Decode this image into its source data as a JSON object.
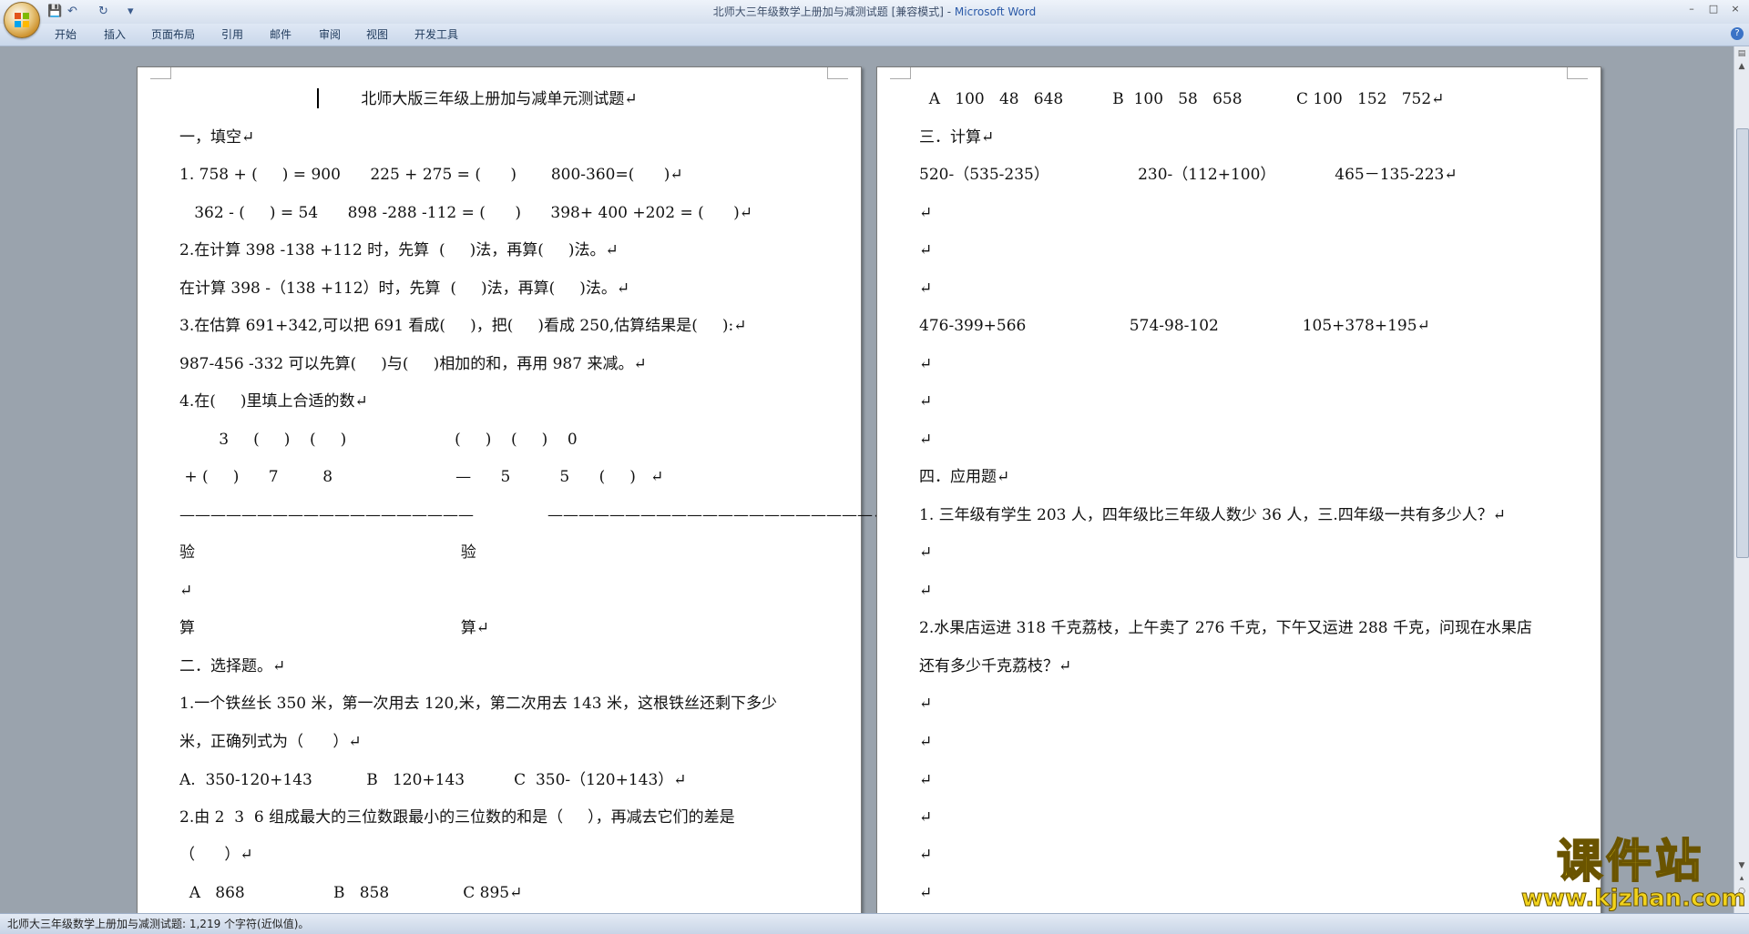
{
  "window": {
    "title_doc": "北师大三年级数学上册加与减测试题 [兼容模式] - ",
    "title_app": "Microsoft Word",
    "controls": [
      "–",
      "□",
      "×"
    ]
  },
  "quick_access": {
    "save": "💾",
    "undo": "↶",
    "redo": "↻",
    "dropdown": "▾"
  },
  "ribbon": {
    "tabs": [
      "开始",
      "插入",
      "页面布局",
      "引用",
      "邮件",
      "审阅",
      "视图",
      "开发工具"
    ],
    "help": "?"
  },
  "page1": [
    "北师大版三年级上册加与减单元测试题↵",
    "一，填空↵",
    "1. 758 + (     ) = 900      225 + 275 = (      )       800-360=(      )↵",
    "   362 - (     ) = 54      898 -288 -112 = (      )      398+ 400 +202 = (      )↵",
    "2.在计算 398 -138 +112 时，先算  (     )法，再算(     )法。↵",
    "在计算 398 -（138 +112）时，先算  (     )法，再算(     )法。↵",
    "3.在估算 691+342,可以把 691 看成(     )，把(     )看成 250,估算结果是(     ):↵",
    "987-456 -332 可以先算(     )与(     )相加的和，再用 987 来减。↵",
    "4.在(     )里填上合适的数↵",
    "        3     (     )    (     )                      (     )    (     )    0",
    " + (     )      7         8                         —      5          5      (     )   ↵",
    "———————————————————               —————————————————————↵",
    "验                                                      验",
    "↵",
    "算                                                      算↵",
    "二．选择题。↵",
    "1.一个铁丝长 350 米，第一次用去 120,米，第二次用去 143 米，这根铁丝还剩下多少",
    "米，正确列式为（      ）↵",
    "A.  350-120+143           B   120+143          C  350-（120+143）↵",
    "2.由 2  3  6 组成最大的三位数跟最小的三位数的和是（     ），再减去它们的差是",
    "（      ）↵",
    "  A   868                  B   858               C 895↵"
  ],
  "page2": [
    "  A   100   48   648          B  100   58   658           C 100   152   752↵",
    "三．计算↵",
    "520-（535-235）                  230-（112+100）            465－135-223↵",
    "↵",
    "↵",
    "↵",
    "476-399+566                     574-98-102                 105+378+195↵",
    "↵",
    "↵",
    "↵",
    "四．应用题↵",
    "1. 三年级有学生 203 人，四年级比三年级人数少 36 人，三.四年级一共有多少人？↵",
    "↵",
    "↵",
    "2.水果店运进 318 千克荔枝，上午卖了 276 千克，下午又运进 288 千克，问现在水果店",
    "还有多少千克荔枝？↵",
    "↵",
    "↵",
    "↵",
    "↵",
    "↵",
    "↵"
  ],
  "statusbar": {
    "text": "北师大三年级数学上册加与减测试题: 1,219 个字符(近似值)。"
  },
  "watermark": {
    "title": "课件站",
    "url": "www.kjzhan.com"
  }
}
